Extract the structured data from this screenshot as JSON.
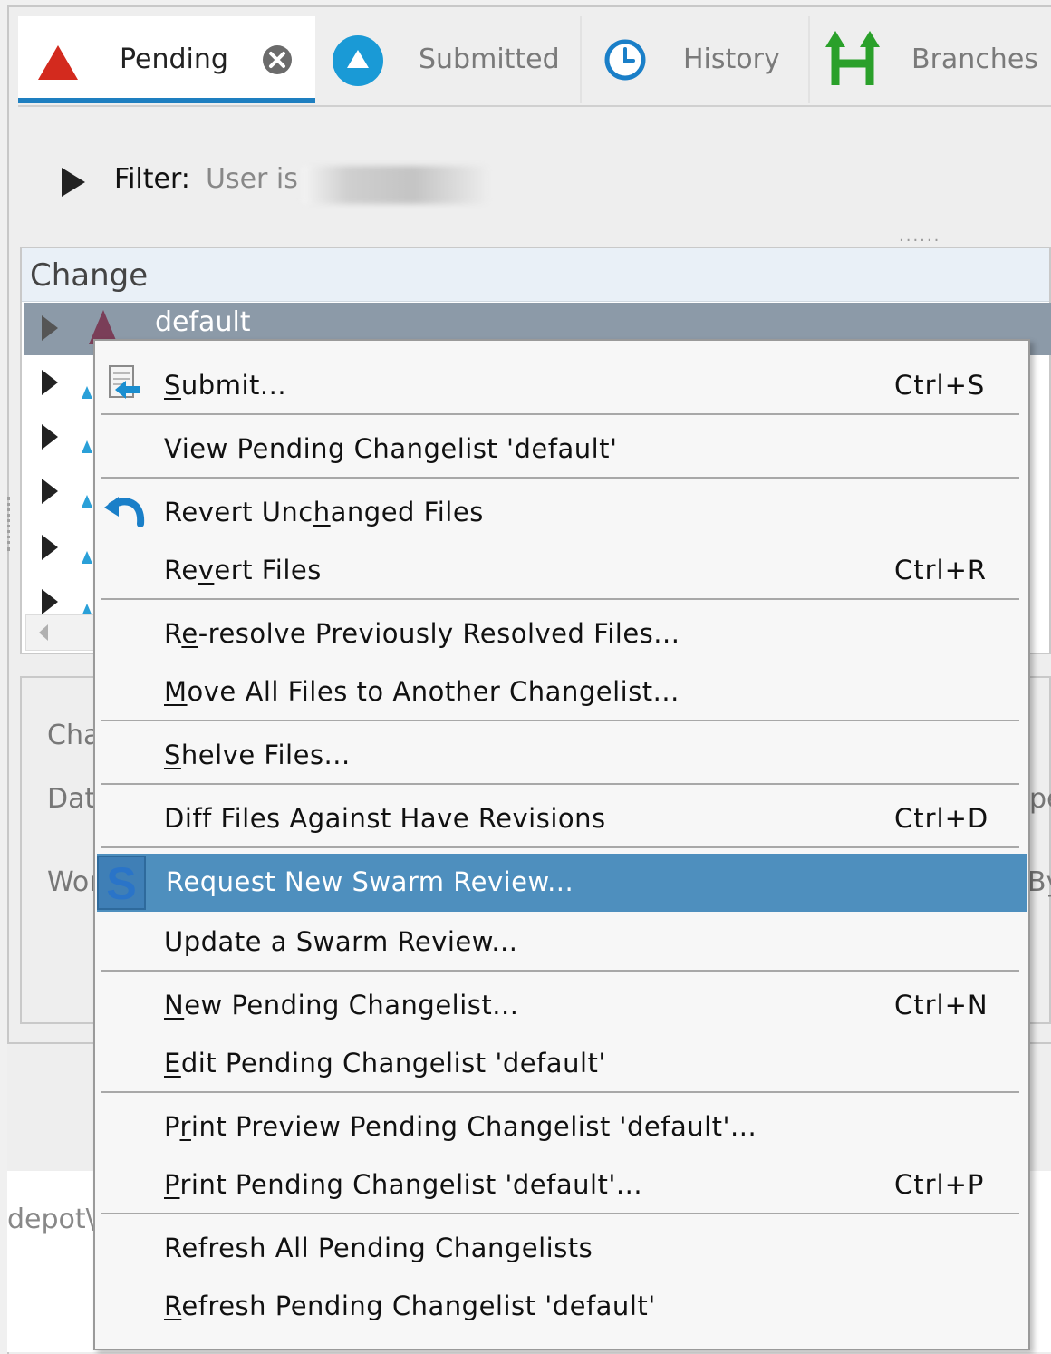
{
  "tabs": [
    {
      "label": "Pending",
      "icon": "pending-triangle-icon",
      "active": true
    },
    {
      "label": "Submitted",
      "icon": "submitted-circle-icon",
      "active": false
    },
    {
      "label": "History",
      "icon": "clock-icon",
      "active": false
    },
    {
      "label": "Branches",
      "icon": "branches-icon",
      "active": false
    }
  ],
  "filter": {
    "label": "Filter:",
    "value": "User is"
  },
  "list": {
    "header": "Change",
    "selected_row": "default"
  },
  "details": {
    "labels": [
      "Cha",
      "Dat",
      "Wor"
    ],
    "right_fragments": [
      "pe",
      "By"
    ]
  },
  "bottom": {
    "path_fragment": "depot\\n"
  },
  "menu": {
    "items": [
      {
        "pre": "",
        "ul": "S",
        "post": "ubmit...",
        "shortcut": "Ctrl+S"
      },
      {
        "pre": "View Pending Changelist 'default'",
        "ul": "",
        "post": "",
        "shortcut": ""
      },
      {
        "pre": "Revert Unc",
        "ul": "h",
        "post": "anged Files",
        "shortcut": ""
      },
      {
        "pre": "Re",
        "ul": "v",
        "post": "ert Files",
        "shortcut": "Ctrl+R"
      },
      {
        "pre": "R",
        "ul": "e",
        "post": "-resolve Previously Resolved Files...",
        "shortcut": ""
      },
      {
        "pre": "",
        "ul": "M",
        "post": "ove All Files to Another Changelist...",
        "shortcut": ""
      },
      {
        "pre": "",
        "ul": "S",
        "post": "helve Files...",
        "shortcut": ""
      },
      {
        "pre": "Diff Files Against Have Revisions",
        "ul": "",
        "post": "",
        "shortcut": "Ctrl+D"
      },
      {
        "pre": "Request New Swarm Review...",
        "ul": "",
        "post": "",
        "shortcut": ""
      },
      {
        "pre": "Update a Swarm Review...",
        "ul": "",
        "post": "",
        "shortcut": ""
      },
      {
        "pre": "",
        "ul": "N",
        "post": "ew Pending Changelist...",
        "shortcut": "Ctrl+N"
      },
      {
        "pre": "",
        "ul": "E",
        "post": "dit Pending Changelist 'default'",
        "shortcut": ""
      },
      {
        "pre": "P",
        "ul": "r",
        "post": "int Preview Pending Changelist 'default'...",
        "shortcut": ""
      },
      {
        "pre": "",
        "ul": "P",
        "post": "rint Pending Changelist 'default'...",
        "shortcut": "Ctrl+P"
      },
      {
        "pre": "Refresh All Pending Changelists",
        "ul": "",
        "post": "",
        "shortcut": ""
      },
      {
        "pre": "",
        "ul": "R",
        "post": "efresh Pending Changelist 'default'",
        "shortcut": ""
      }
    ]
  },
  "colors": {
    "accent": "#1e7fc0",
    "highlight": "#4e8fbe",
    "pending_red": "#d32a1e",
    "branches_green": "#2aa02a"
  }
}
